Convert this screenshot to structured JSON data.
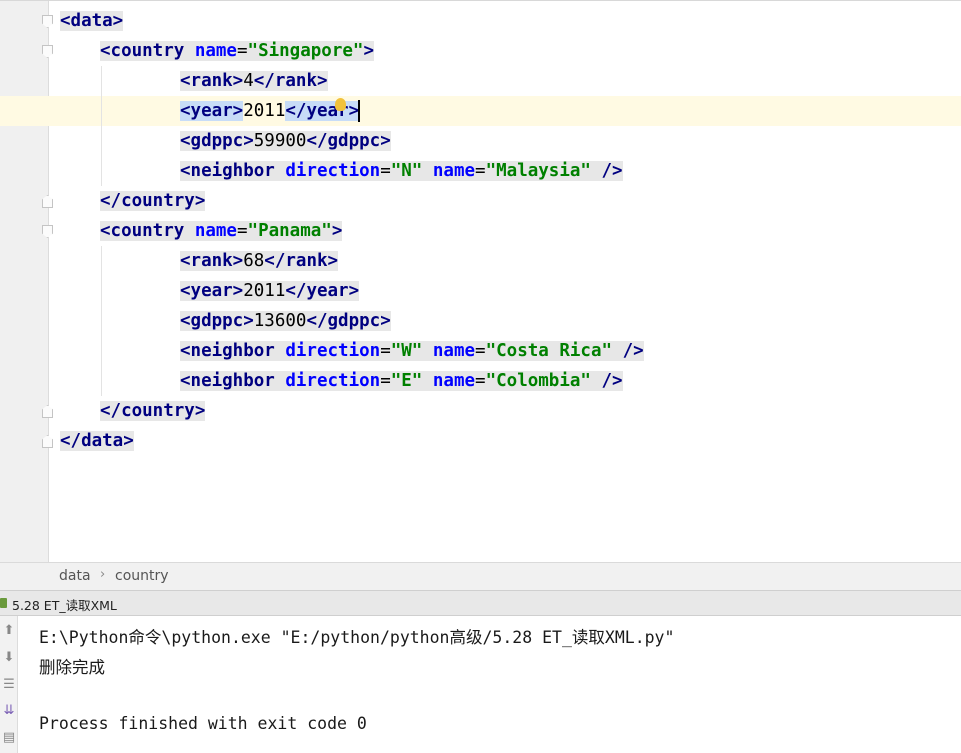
{
  "editor": {
    "lines": [
      [
        {
          "c": "tg",
          "t": "<data>"
        }
      ],
      [
        {
          "c": "tg",
          "t": "<country "
        },
        {
          "c": "at",
          "t": "name"
        },
        {
          "c": "pl",
          "t": "="
        },
        {
          "c": "vl",
          "t": "\"Singapore\""
        },
        {
          "c": "tg",
          "t": ">"
        }
      ],
      [
        {
          "c": "tg",
          "t": "<rank>"
        },
        {
          "c": "pl",
          "t": "4"
        },
        {
          "c": "tg",
          "t": "</rank>"
        }
      ],
      [
        {
          "c": "tg hl",
          "t": "<year>"
        },
        {
          "c": "pl",
          "t": "2011"
        },
        {
          "c": "tg hl",
          "t": "</year>"
        }
      ],
      [
        {
          "c": "tg",
          "t": "<gdppc>"
        },
        {
          "c": "pl",
          "t": "59900"
        },
        {
          "c": "tg",
          "t": "</gdppc>"
        }
      ],
      [
        {
          "c": "tg",
          "t": "<neighbor "
        },
        {
          "c": "at",
          "t": "direction"
        },
        {
          "c": "pl",
          "t": "="
        },
        {
          "c": "vl",
          "t": "\"N\""
        },
        {
          "c": "pl",
          "t": " "
        },
        {
          "c": "at",
          "t": "name"
        },
        {
          "c": "pl",
          "t": "="
        },
        {
          "c": "vl",
          "t": "\"Malaysia\""
        },
        {
          "c": "tg",
          "t": " />"
        }
      ],
      [
        {
          "c": "tg",
          "t": "</country>"
        }
      ],
      [
        {
          "c": "tg",
          "t": "<country "
        },
        {
          "c": "at",
          "t": "name"
        },
        {
          "c": "pl",
          "t": "="
        },
        {
          "c": "vl",
          "t": "\"Panama\""
        },
        {
          "c": "tg",
          "t": ">"
        }
      ],
      [
        {
          "c": "tg",
          "t": "<rank>"
        },
        {
          "c": "pl",
          "t": "68"
        },
        {
          "c": "tg",
          "t": "</rank>"
        }
      ],
      [
        {
          "c": "tg",
          "t": "<year>"
        },
        {
          "c": "pl",
          "t": "2011"
        },
        {
          "c": "tg",
          "t": "</year>"
        }
      ],
      [
        {
          "c": "tg",
          "t": "<gdppc>"
        },
        {
          "c": "pl",
          "t": "13600"
        },
        {
          "c": "tg",
          "t": "</gdppc>"
        }
      ],
      [
        {
          "c": "tg",
          "t": "<neighbor "
        },
        {
          "c": "at",
          "t": "direction"
        },
        {
          "c": "pl",
          "t": "="
        },
        {
          "c": "vl",
          "t": "\"W\""
        },
        {
          "c": "pl",
          "t": " "
        },
        {
          "c": "at",
          "t": "name"
        },
        {
          "c": "pl",
          "t": "="
        },
        {
          "c": "vl",
          "t": "\"Costa Rica\""
        },
        {
          "c": "tg",
          "t": " />"
        }
      ],
      [
        {
          "c": "tg",
          "t": "<neighbor "
        },
        {
          "c": "at",
          "t": "direction"
        },
        {
          "c": "pl",
          "t": "="
        },
        {
          "c": "vl",
          "t": "\"E\""
        },
        {
          "c": "pl",
          "t": " "
        },
        {
          "c": "at",
          "t": "name"
        },
        {
          "c": "pl",
          "t": "="
        },
        {
          "c": "vl",
          "t": "\"Colombia\""
        },
        {
          "c": "tg",
          "t": " />"
        }
      ],
      [
        {
          "c": "tg",
          "t": "</country>"
        }
      ],
      [
        {
          "c": "tg",
          "t": "</data>"
        }
      ]
    ]
  },
  "breadcrumb": {
    "items": [
      "data",
      "country"
    ],
    "separator": "›"
  },
  "run_tab": {
    "label": "5.28 ET_读取XML"
  },
  "console": {
    "lines": [
      "E:\\Python命令\\python.exe \"E:/python/python高级/5.28 ET_读取XML.py\"",
      "删除完成",
      "",
      "Process finished with exit code 0"
    ]
  },
  "colors": {
    "tag": "#000080",
    "attribute": "#0000ff",
    "value": "#008000",
    "caret_line": "#fffae3",
    "match_highlight": "#c7dcf7"
  }
}
